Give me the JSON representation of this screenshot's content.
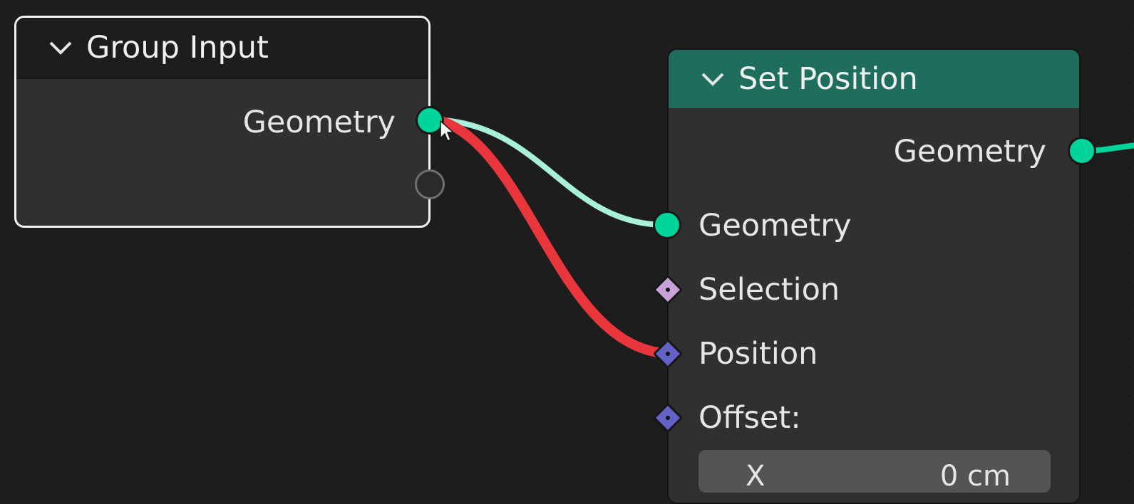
{
  "editor": {
    "background_color": "#1d1d1d"
  },
  "nodes": {
    "group_input": {
      "title": "Group Input",
      "header_color": "#1d1d1d",
      "outputs": [
        {
          "label": "Geometry",
          "type": "geometry",
          "color": "#00d49a"
        },
        {
          "label": "",
          "type": "empty"
        }
      ]
    },
    "set_position": {
      "title": "Set Position",
      "header_color": "#1f6e5d",
      "outputs": [
        {
          "label": "Geometry",
          "type": "geometry",
          "color": "#00d49a"
        }
      ],
      "inputs": [
        {
          "label": "Geometry",
          "type": "geometry",
          "color": "#00d49a"
        },
        {
          "label": "Selection",
          "type": "boolean",
          "color": "#c8a2d9"
        },
        {
          "label": "Position",
          "type": "vector",
          "color": "#6363c7"
        },
        {
          "label": "Offset:",
          "type": "vector",
          "color": "#6363c7"
        }
      ],
      "offset_field": {
        "axis": "X",
        "value": "0 cm"
      }
    }
  },
  "links": [
    {
      "from": "Group Input.Geometry",
      "to": "Set Position.Geometry",
      "color": "#a9f0da",
      "state": "valid"
    },
    {
      "from": "Group Input.Geometry",
      "to": "Set Position.Position",
      "color": "#e8363c",
      "state": "invalid"
    }
  ],
  "icons": {
    "collapse": "chevron-down-icon",
    "cursor": "mouse-pointer-icon"
  }
}
